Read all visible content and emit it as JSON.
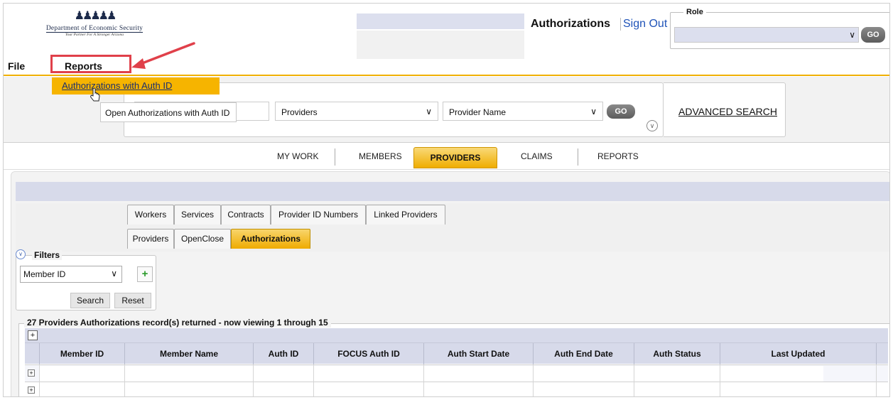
{
  "header": {
    "logo_dept": "Department of Economic Security",
    "logo_tagline": "Your Partner For A Stronger Arizona",
    "app_title": "Authorizations",
    "sign_out": "Sign Out",
    "role_legend": "Role",
    "role_go": "GO"
  },
  "menubar": {
    "file": "File",
    "reports": "Reports",
    "dropdown_item": "Authorizations with Auth ID",
    "tooltip": "Open Authorizations with Auth ID"
  },
  "search": {
    "type_select": "Providers",
    "field_select": "Provider Name",
    "go": "GO",
    "advanced": "ADVANCED SEARCH"
  },
  "main_tabs": [
    "MY WORK",
    "MEMBERS",
    "PROVIDERS",
    "CLAIMS",
    "REPORTS"
  ],
  "main_tab_active": "PROVIDERS",
  "sub_tabs_row1": [
    "Workers",
    "Services",
    "Contracts",
    "Provider ID Numbers",
    "Linked Providers"
  ],
  "sub_tabs_row2": [
    "Providers",
    "OpenClose",
    "Authorizations"
  ],
  "sub_tab_active": "Authorizations",
  "filters": {
    "legend": "Filters",
    "select_value": "Member ID",
    "add": "+",
    "search": "Search",
    "reset": "Reset"
  },
  "grid": {
    "records_label": "27 Providers Authorizations record(s) returned - now viewing 1 through 15",
    "toolbar_plus": "+",
    "columns": [
      "Member ID",
      "Member Name",
      "Auth ID",
      "FOCUS Auth ID",
      "Auth Start Date",
      "Auth End Date",
      "Auth Status",
      "Last Updated"
    ],
    "row_expander": "+"
  },
  "colors": {
    "accent": "#efad00",
    "header_blue": "#d7daea",
    "highlight_red": "#e0404a",
    "link_blue": "#1f53b8"
  }
}
